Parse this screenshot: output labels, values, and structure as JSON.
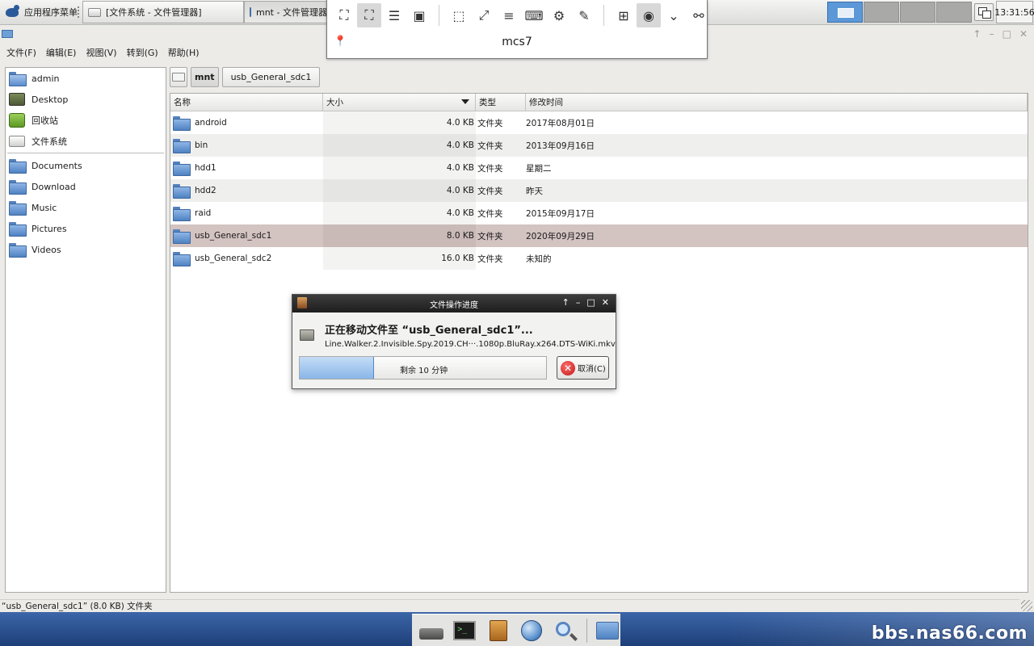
{
  "taskbar": {
    "apps_menu_label": "应用程序菜单",
    "tasks": [
      {
        "label": "[文件系统 - 文件管理器]"
      },
      {
        "label": "mnt - 文件管理器"
      }
    ],
    "clock": "13:31:56"
  },
  "remote_toolbar": {
    "host": "mcs7",
    "icons": [
      "fit-window-icon",
      "fullscreen-icon",
      "menu-icon",
      "scale-icon",
      "view-only-icon",
      "grab-keyboard-icon",
      "toolbar-menu-icon",
      "keyboard-icon",
      "preferences-icon",
      "tools-icon",
      "duplicate-icon",
      "screenshot-icon",
      "chevron-down-icon",
      "disconnect-icon",
      "pin-icon"
    ]
  },
  "file_manager": {
    "menu": [
      "文件(F)",
      "编辑(E)",
      "视图(V)",
      "转到(G)",
      "帮助(H)"
    ],
    "sidebar": {
      "places": [
        {
          "label": "admin",
          "icon": "home-folder-icon"
        },
        {
          "label": "Desktop",
          "icon": "desktop-icon"
        },
        {
          "label": "回收站",
          "icon": "trash-icon"
        },
        {
          "label": "文件系统",
          "icon": "drive-icon"
        }
      ],
      "bookmarks": [
        {
          "label": "Documents",
          "icon": "folder-icon"
        },
        {
          "label": "Download",
          "icon": "folder-icon"
        },
        {
          "label": "Music",
          "icon": "folder-icon"
        },
        {
          "label": "Pictures",
          "icon": "folder-icon"
        },
        {
          "label": "Videos",
          "icon": "folder-icon"
        }
      ]
    },
    "path": [
      "mnt",
      "usb_General_sdc1"
    ],
    "columns": {
      "name": "名称",
      "size": "大小",
      "type": "类型",
      "modified": "修改时间"
    },
    "files": [
      {
        "name": "android",
        "size": "4.0 KB",
        "type": "文件夹",
        "modified": "2017年08月01日"
      },
      {
        "name": "bin",
        "size": "4.0 KB",
        "type": "文件夹",
        "modified": "2013年09月16日"
      },
      {
        "name": "hdd1",
        "size": "4.0 KB",
        "type": "文件夹",
        "modified": "星期二"
      },
      {
        "name": "hdd2",
        "size": "4.0 KB",
        "type": "文件夹",
        "modified": "昨天"
      },
      {
        "name": "raid",
        "size": "4.0 KB",
        "type": "文件夹",
        "modified": "2015年09月17日"
      },
      {
        "name": "usb_General_sdc1",
        "size": "8.0 KB",
        "type": "文件夹",
        "modified": "2020年09月29日",
        "selected": true
      },
      {
        "name": "usb_General_sdc2",
        "size": "16.0 KB",
        "type": "文件夹",
        "modified": "未知的"
      }
    ],
    "status": "“usb_General_sdc1” (8.0 KB) 文件夹"
  },
  "progress_dialog": {
    "title": "文件操作进度",
    "heading": "正在移动文件至 “usb_General_sdc1”...",
    "filename": "Line.Walker.2.Invisible.Spy.2019.CH···.1080p.BluRay.x264.DTS-WiKi.mkv",
    "progress_fraction": 0.3,
    "progress_text": "剩余 10 分钟",
    "cancel_label": "取消(C)"
  },
  "dock": {
    "icons": [
      "drive-icon",
      "terminal-icon",
      "file-cabinet-icon",
      "web-browser-icon",
      "search-icon",
      "folder-icon"
    ],
    "watermark": "bbs.nas66.com"
  }
}
